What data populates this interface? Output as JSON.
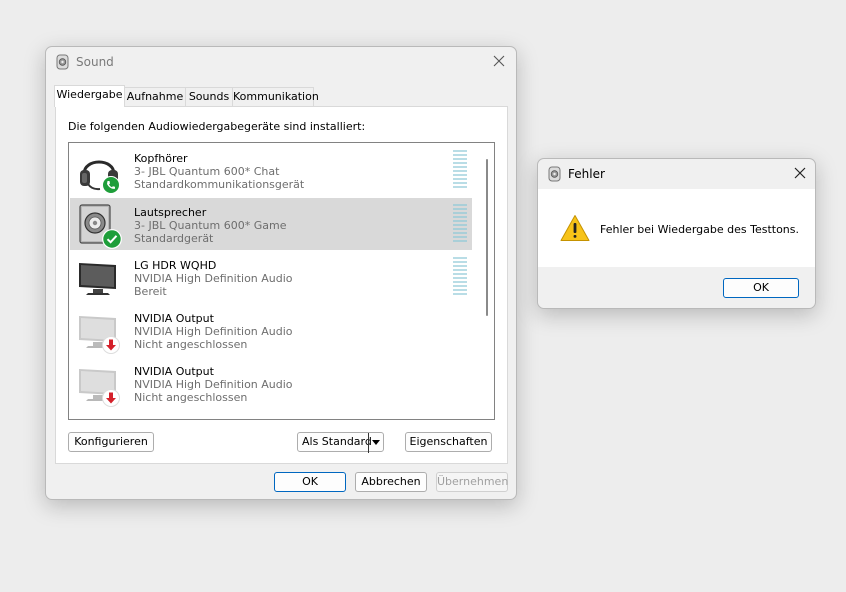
{
  "sound_window": {
    "title": "Sound",
    "tabs": [
      "Wiedergabe",
      "Aufnahme",
      "Sounds",
      "Kommunikation"
    ],
    "active_tab": "Wiedergabe",
    "intro": "Die folgenden Audiowiedergabegeräte sind installiert:",
    "devices": [
      {
        "name": "Kopfhörer",
        "desc": "3- JBL Quantum 600* Chat",
        "status": "Standardkommunikationsgerät",
        "icon": "headset-icon",
        "badge": "phone-badge-icon",
        "selected": false
      },
      {
        "name": "Lautsprecher",
        "desc": "3- JBL Quantum 600* Game",
        "status": "Standardgerät",
        "icon": "speaker-icon",
        "badge": "check-badge-icon",
        "selected": true
      },
      {
        "name": "LG HDR WQHD",
        "desc": "NVIDIA High Definition Audio",
        "status": "Bereit",
        "icon": "monitor-icon",
        "badge": "",
        "selected": false
      },
      {
        "name": "NVIDIA Output",
        "desc": "NVIDIA High Definition Audio",
        "status": "Nicht angeschlossen",
        "icon": "monitor-disconnected-icon",
        "badge": "down-arrow-badge-icon",
        "selected": false
      },
      {
        "name": "NVIDIA Output",
        "desc": "NVIDIA High Definition Audio",
        "status": "Nicht angeschlossen",
        "icon": "monitor-disconnected-icon",
        "badge": "down-arrow-badge-icon",
        "selected": false
      }
    ],
    "buttons": {
      "configure": "Konfigurieren",
      "set_default": "Als Standard",
      "properties": "Eigenschaften",
      "ok": "OK",
      "cancel": "Abbrechen",
      "apply": "Übernehmen"
    }
  },
  "error_dialog": {
    "title": "Fehler",
    "message": "Fehler bei Wiedergabe des Testtons.",
    "ok": "OK"
  },
  "colors": {
    "selected_row": "#d9d9d9",
    "primary_border": "#0067c0",
    "badge_green": "#1e9e3a",
    "badge_red": "#d4202a",
    "warning_yellow": "#f7c318"
  }
}
